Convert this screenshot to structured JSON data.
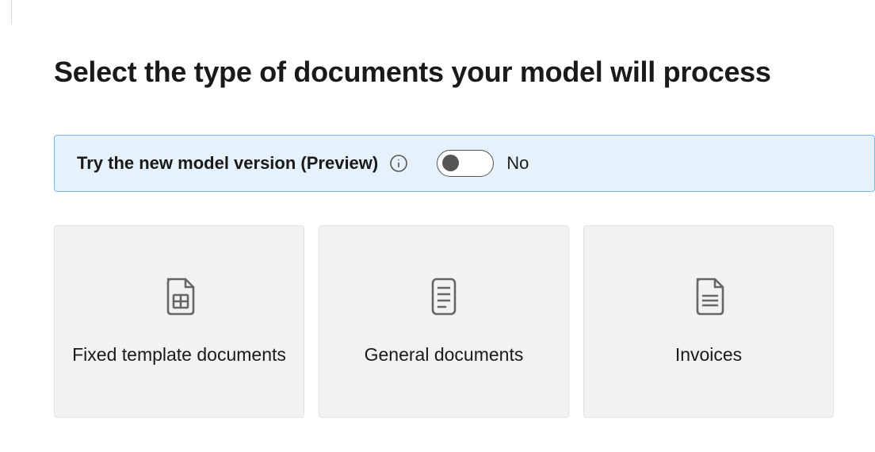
{
  "title": "Select the type of documents your model will process",
  "notice": {
    "label": "Try the new model version (Preview)",
    "toggle_state": "No"
  },
  "cards": [
    {
      "label": "Fixed template documents"
    },
    {
      "label": "General documents"
    },
    {
      "label": "Invoices"
    }
  ]
}
